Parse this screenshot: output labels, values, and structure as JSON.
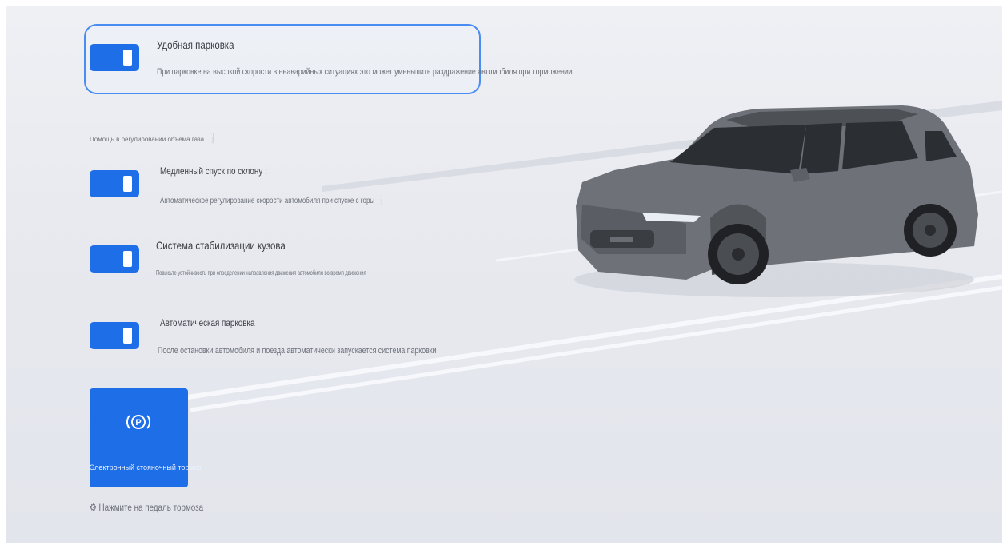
{
  "settings": [
    {
      "title": "Удобная парковка",
      "description": "При парковке на высокой скорости в неаварийных ситуациях это может уменьшить раздражение автомобиля при торможении.",
      "enabled": true
    },
    {
      "title": "Медленный спуск по склону",
      "description": "Автоматическое регулирование скорости автомобиля при спуске с горы",
      "enabled": true
    },
    {
      "title": "Система стабилизации кузова",
      "description": "Повысьте устойчивость при определении направления движения автомобиля во время движения",
      "enabled": true
    },
    {
      "title": "Автоматическая парковка",
      "description": "После остановки автомобиля и поезда автоматически запускается система парковки",
      "enabled": true
    }
  ],
  "section_label": "Помощь в регулировании объема газа",
  "epb": {
    "label": "Электронный стояночный тормоз",
    "icon": "parking-brake-icon"
  },
  "brake_hint": "Нажмите на педаль тормоза",
  "colors": {
    "accent": "#1e6ee8",
    "highlight_border": "#4a8df2",
    "background": "#e8eaef"
  }
}
